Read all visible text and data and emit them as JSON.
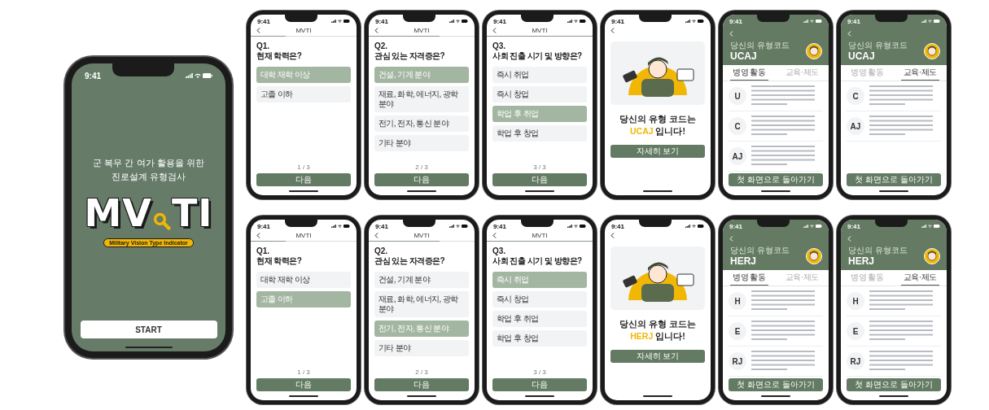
{
  "start_screen": {
    "time": "9:41",
    "subtitle": [
      "군 복무 간 여가 활용을 위한",
      "진로설계 유형검사"
    ],
    "logo": [
      "MV",
      "TI"
    ],
    "tagline": "Military Vision Type Indicator",
    "button": "START"
  },
  "screens": [
    {
      "kind": "question",
      "time": "9:41",
      "title": "MVTI",
      "level": 0.333,
      "number": "Q1.",
      "question": "현재 학력은?",
      "options": [
        {
          "label": "대학 재학 이상",
          "selected": true
        },
        {
          "label": "고졸 이하",
          "selected": false
        }
      ],
      "progress": "1 / 3",
      "button": "다음"
    },
    {
      "kind": "question",
      "time": "9:41",
      "title": "MVTI",
      "level": 0.667,
      "number": "Q2.",
      "question": "관심 있는 자격증은?",
      "options": [
        {
          "label": "건설, 기계 분야",
          "selected": true
        },
        {
          "label": "재료, 화학, 에너지, 광학 분야",
          "selected": false
        },
        {
          "label": "전기, 전자, 통신 분야",
          "selected": false
        },
        {
          "label": "기타 분야",
          "selected": false
        }
      ],
      "progress": "2 / 3",
      "button": "다음"
    },
    {
      "kind": "question",
      "time": "9:41",
      "title": "MVTI",
      "level": 1,
      "number": "Q3.",
      "question": "사회 진출 시기 및 방향은?",
      "options": [
        {
          "label": "즉시 취업",
          "selected": false
        },
        {
          "label": "즉시 창업",
          "selected": false
        },
        {
          "label": "학업 후 취업",
          "selected": true
        },
        {
          "label": "학업 후 창업",
          "selected": false
        }
      ],
      "progress": "3 / 3",
      "button": "다음"
    },
    {
      "kind": "result",
      "time": "9:41",
      "line_1": "당신의 유형 코드는",
      "code": "UCAJ",
      "suffix": "입니다!",
      "button": "자세히 보기"
    },
    {
      "kind": "detail",
      "time": "9:41",
      "caption": "당신의 유형코드",
      "code": "UCAJ",
      "tabs": [
        {
          "label": "병영 활동",
          "selected": true
        },
        {
          "label": "교육·제도",
          "selected": false
        }
      ],
      "sections": [
        "U",
        "C",
        "AJ"
      ],
      "button": "첫 화면으로 돌아가기"
    },
    {
      "kind": "detail",
      "time": "9:41",
      "caption": "당신의 유형코드",
      "code": "UCAJ",
      "tabs": [
        {
          "label": "병영 활동",
          "selected": false
        },
        {
          "label": "교육·제도",
          "selected": true
        }
      ],
      "sections": [
        "C",
        "AJ"
      ],
      "button": "첫 화면으로 돌아가기"
    },
    {
      "kind": "question",
      "time": "9:41",
      "title": "MVTI",
      "level": 0.333,
      "number": "Q1.",
      "question": "현재 학력은?",
      "options": [
        {
          "label": "대학 재학 이상",
          "selected": false
        },
        {
          "label": "고졸 이하",
          "selected": true
        }
      ],
      "progress": "1 / 3",
      "button": "다음"
    },
    {
      "kind": "question",
      "time": "9:41",
      "title": "MVTI",
      "level": 0.667,
      "number": "Q2.",
      "question": "관심 있는 자격증은?",
      "options": [
        {
          "label": "건설, 기계 분야",
          "selected": false
        },
        {
          "label": "재료, 화학, 에너지, 광학 분야",
          "selected": false
        },
        {
          "label": "전기, 전자, 통신 분야",
          "selected": true
        },
        {
          "label": "기타 분야",
          "selected": false
        }
      ],
      "progress": "2 / 3",
      "button": "다음"
    },
    {
      "kind": "question",
      "time": "9:41",
      "title": "MVTI",
      "level": 1,
      "number": "Q3.",
      "question": "사회 진출 시기 및 방향은?",
      "options": [
        {
          "label": "즉시 취업",
          "selected": true
        },
        {
          "label": "즉시 창업",
          "selected": false
        },
        {
          "label": "학업 후 취업",
          "selected": false
        },
        {
          "label": "학업 후 창업",
          "selected": false
        }
      ],
      "progress": "3 / 3",
      "button": "다음"
    },
    {
      "kind": "result",
      "time": "9:41",
      "line_1": "당신의 유형 코드는",
      "code": "HERJ",
      "suffix": "입니다!",
      "button": "자세히 보기"
    },
    {
      "kind": "detail",
      "time": "9:41",
      "caption": "당신의 유형코드",
      "code": "HERJ",
      "tabs": [
        {
          "label": "병영 활동",
          "selected": true
        },
        {
          "label": "교육·제도",
          "selected": false
        }
      ],
      "sections": [
        "H",
        "E",
        "RJ"
      ],
      "button": "첫 화면으로 돌아가기"
    },
    {
      "kind": "detail",
      "time": "9:41",
      "caption": "당신의 유형코드",
      "code": "HERJ",
      "tabs": [
        {
          "label": "병영 활동",
          "selected": false
        },
        {
          "label": "교육·제도",
          "selected": true
        }
      ],
      "sections": [
        "H",
        "E",
        "RJ"
      ],
      "button": "첫 화면으로 돌아가기"
    }
  ]
}
